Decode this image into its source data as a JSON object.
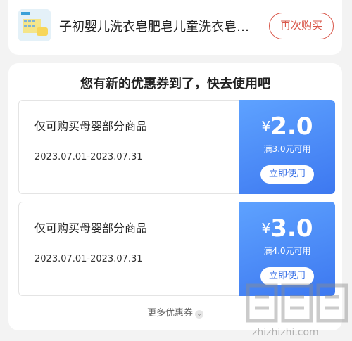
{
  "product": {
    "name": "子初婴儿洗衣皂肥皂儿童洗衣皂…",
    "rebuy_label": "再次购买"
  },
  "coupon_panel": {
    "title": "您有新的优惠券到了，快去使用吧",
    "coupons": [
      {
        "scope": "仅可购买母婴部分商品",
        "validity": "2023.07.01-2023.07.31",
        "currency": "¥",
        "amount": "2.0",
        "threshold": "满3.0元可用",
        "use_label": "立即使用"
      },
      {
        "scope": "仅可购买母婴部分商品",
        "validity": "2023.07.01-2023.07.31",
        "currency": "¥",
        "amount": "3.0",
        "threshold": "满4.0元可用",
        "use_label": "立即使用"
      }
    ],
    "more_label": "更多优惠券"
  },
  "watermark": {
    "url": "zhizhizhi.com"
  },
  "colors": {
    "accent_red": "#d9574a",
    "coupon_blue": "#3d78f0"
  }
}
